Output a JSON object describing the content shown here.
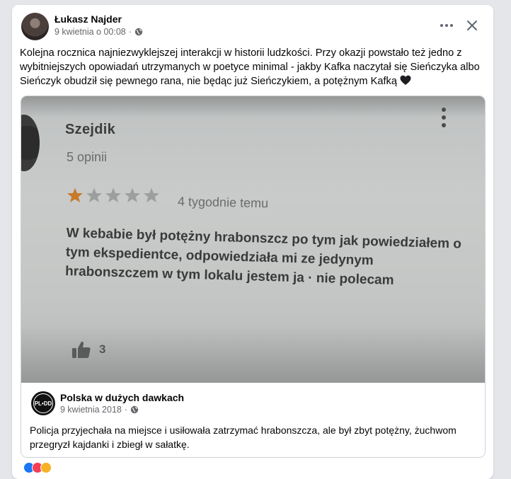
{
  "post": {
    "author": "Łukasz Najder",
    "timestamp": "9 kwietnia o 00:08",
    "audience_icon": "globe-icon",
    "text": "Kolejna rocznica najniezwyklejszej interakcji w historii ludzkości. Przy okazji powstało też jedno z wybitniejszych opowiadań utrzymanych w poetyce minimal - jakby Kafka naczytał się Sieńczyka albo Sieńczyk obudził się pewnego rana, nie będąc już Sieńczykiem, a potężnym Kafką",
    "emoji": "black-heart"
  },
  "photo": {
    "reviewer": "Szejdik",
    "review_count": "5 opinii",
    "rating": 1,
    "rating_max": 5,
    "time": "4 tygodnie temu",
    "review_text": "W kebabie był potężny hrabonszcz po tym jak powiedziałem o tym ekspedientce, odpowiedziała mi ze jedynym hrabonszczem w tym lokalu jestem ja · nie polecam",
    "likes": "3",
    "star_color": "#c77a2a"
  },
  "source": {
    "page_name": "Polska w dużych dawkach",
    "logo_text": "PL•DD",
    "date": "9 kwietnia 2018",
    "text": "Policja przyjechała na miejsce i usiłowała zatrzymać hrabonszcza, ale był zbyt potężny, żuchwom przegryzł kajdanki i zbiegł w sałatkę."
  },
  "colors": {
    "background": "#e4e6ea",
    "card": "#ffffff",
    "secondary_text": "#65676b"
  }
}
